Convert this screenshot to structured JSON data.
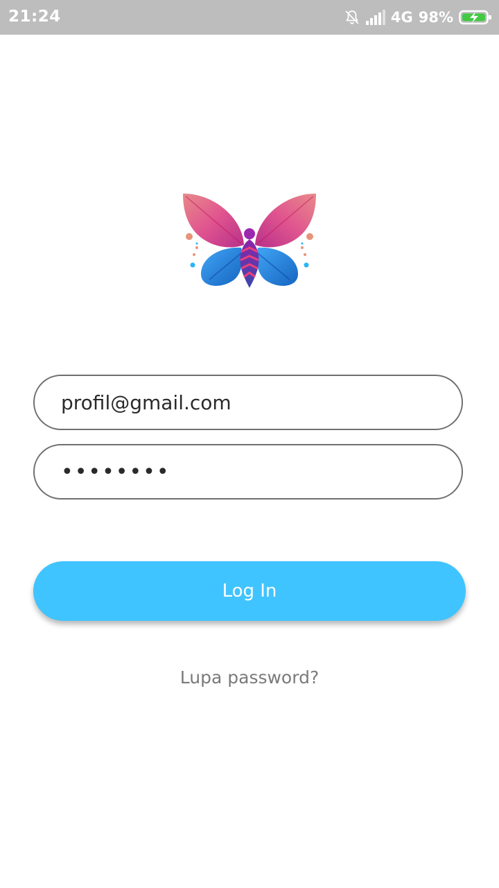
{
  "status_bar": {
    "time": "21:24",
    "network": "4G",
    "battery": "98%",
    "icons": [
      "mute-bell-icon",
      "signal-icon",
      "battery-charging-icon"
    ]
  },
  "logo": {
    "icon": "butterfly-logo",
    "colors": {
      "top_wing": "#e05a9b",
      "bottom_wing": "#1e88e5",
      "accent_dots": "#e8947a"
    }
  },
  "login_form": {
    "email_value": "profil@gmail.com",
    "password_value": "12345678",
    "login_label": "Log In",
    "forgot_label": "Lupa password?"
  },
  "colors": {
    "accent": "#40c4ff",
    "field_border": "#6f6f6f",
    "status_bar_bg": "#bdbdbd"
  }
}
